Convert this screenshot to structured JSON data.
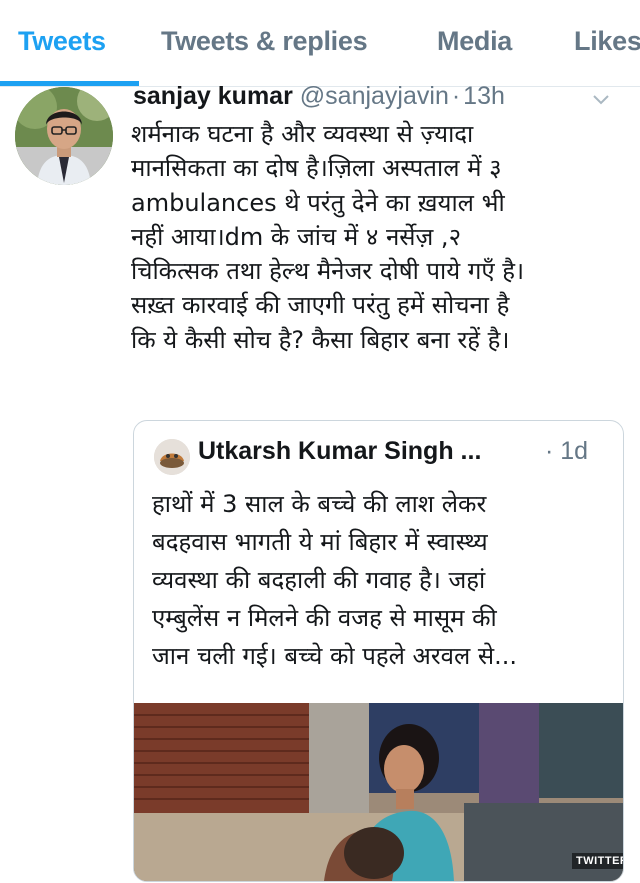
{
  "tabs": [
    {
      "label": "Tweets",
      "active": true
    },
    {
      "label": "Tweets & replies",
      "active": false
    },
    {
      "label": "Media",
      "active": false
    },
    {
      "label": "Likes",
      "active": false
    }
  ],
  "tweet": {
    "author_name": "sanjay kumar",
    "author_handle": "@sanjayjavin",
    "separator": "·",
    "time": "13h",
    "lines": [
      "शर्मनाक घटना है और व्यवस्था से ज़्यादा",
      "मानसिकता का दोष है।ज़िला अस्पताल में ३",
      "ambulances थे परंतु देने का ख़याल भी",
      "नहीं आया।dm के जांच में ४ नर्सेज़ ,२",
      "चिकित्सक तथा हेल्थ मैनेजर दोषी पाये गएँ है।",
      "सख़्त कारवाई की जाएगी परंतु हमें सोचना है",
      "कि ये कैसी सोच है? कैसा बिहार बना रहें है।"
    ]
  },
  "quoted": {
    "author_name": "Utkarsh Kumar Singh ...",
    "time": "· 1d",
    "lines": [
      "हाथों में 3 साल के बच्चे की लाश लेकर",
      "बदहवास भागती ये मां बिहार में स्वास्थ्य",
      "व्यवस्था की बदहाली की गवाह है। जहां",
      "एम्बुलेंस न मिलने की वजह से मासूम की",
      "जान चली गई। बच्चे को पहले अरवल से..."
    ],
    "watermark": "TWITTER"
  },
  "colors": {
    "accent": "#1da1f2",
    "text": "#14171a",
    "muted": "#657786",
    "border": "#ccd6dd"
  },
  "icons": {
    "caret": "chevron-down-icon"
  }
}
